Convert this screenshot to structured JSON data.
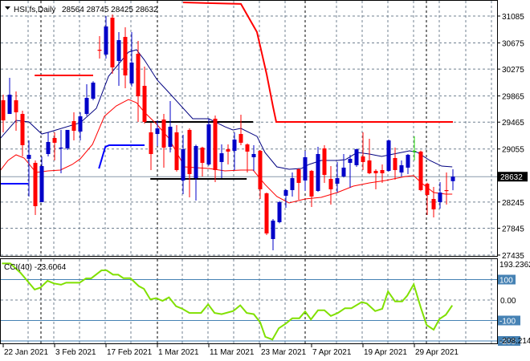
{
  "header": {
    "symbol_label": "HSI,fs,Daily",
    "ohlc": "28564 28745 28425 28632"
  },
  "price_axis": {
    "labels": [
      31085,
      30675,
      30275,
      29865,
      29465,
      29055,
      28245,
      27845,
      27435
    ],
    "current": 28632,
    "current_label": "28632"
  },
  "cci": {
    "label": "CCI(40) -23.6064",
    "max_label": "193.2362",
    "min_label": "-208.214",
    "levels": [
      {
        "value": 100,
        "label": "100",
        "boxed": true
      },
      {
        "value": 0,
        "label": "0.00",
        "boxed": false
      },
      {
        "value": -100,
        "label": "-100",
        "boxed": true
      },
      {
        "value": -200,
        "label": "-200",
        "boxed": true
      }
    ]
  },
  "dates": [
    {
      "bar": 0,
      "label": "22 Jan 2021"
    },
    {
      "bar": 8,
      "label": "3 Feb 2021"
    },
    {
      "bar": 16,
      "label": "17 Feb 2021"
    },
    {
      "bar": 24,
      "label": "1 Mar 2021"
    },
    {
      "bar": 32,
      "label": "11 Mar 2021"
    },
    {
      "bar": 40,
      "label": "23 Mar 2021"
    },
    {
      "bar": 48,
      "label": "7 Apr 2021"
    },
    {
      "bar": 56,
      "label": "19 Apr 2021"
    },
    {
      "bar": 64,
      "label": "29 Apr 2021"
    }
  ],
  "colors": {
    "bull": "#0000C8",
    "bear": "#FF0000",
    "doji": "#22DD00",
    "ma_fast": "#000080",
    "ma_slow": "#FF0000",
    "cci": "#80E000",
    "level": "#4682B4",
    "grid": "#708090"
  },
  "chart_data": {
    "type": "candlestick",
    "title": "HSI,fs,Daily",
    "ylim": [
      27435,
      31085
    ],
    "ohlc": [
      [
        29799,
        29884,
        29309,
        29492
      ],
      [
        29590,
        30142,
        29590,
        29884
      ],
      [
        29799,
        29933,
        29333,
        29615
      ],
      [
        29590,
        29639,
        28941,
        29113
      ],
      [
        28904,
        29186,
        28329,
        28966
      ],
      [
        28843,
        28880,
        28047,
        28182
      ],
      [
        28243,
        28941,
        28243,
        28794
      ],
      [
        28978,
        29309,
        28941,
        29162
      ],
      [
        29223,
        29309,
        28880,
        29150
      ],
      [
        29064,
        29346,
        28684,
        29076
      ],
      [
        29064,
        29346,
        29040,
        29346
      ],
      [
        29480,
        29615,
        29186,
        29333
      ],
      [
        29321,
        29615,
        29186,
        29554
      ],
      [
        29590,
        30044,
        29560,
        29835
      ],
      [
        29823,
        30090,
        29799,
        30068
      ],
      [
        30570,
        30779,
        30436,
        30558
      ],
      [
        30497,
        31085,
        30436,
        30926
      ],
      [
        31060,
        31110,
        30203,
        30301
      ],
      [
        30399,
        30840,
        30019,
        30717
      ],
      [
        30766,
        30913,
        29982,
        30178
      ],
      [
        30056,
        30840,
        30007,
        30374
      ],
      [
        30509,
        30705,
        29468,
        29860
      ],
      [
        30019,
        30313,
        29440,
        29468
      ],
      [
        29309,
        29456,
        28733,
        28978
      ],
      [
        29284,
        29492,
        29100,
        29370
      ],
      [
        29505,
        29590,
        28770,
        29076
      ],
      [
        29088,
        29786,
        29002,
        29395
      ],
      [
        29309,
        29419,
        28710,
        28733
      ],
      [
        28574,
        29272,
        28365,
        29051
      ],
      [
        29346,
        29370,
        28316,
        28672
      ],
      [
        28610,
        29120,
        28267,
        29100
      ],
      [
        29076,
        29090,
        28635,
        28843
      ],
      [
        28819,
        29517,
        28800,
        29431
      ],
      [
        29517,
        29566,
        28549,
        28733
      ],
      [
        28856,
        29125,
        28610,
        28990
      ],
      [
        29051,
        29125,
        28819,
        29015
      ],
      [
        29027,
        29309,
        28733,
        29199
      ],
      [
        29284,
        29578,
        29113,
        29150
      ],
      [
        29125,
        29140,
        28696,
        29015
      ],
      [
        28929,
        29113,
        28721,
        28978
      ],
      [
        29027,
        29040,
        28292,
        28439
      ],
      [
        28378,
        28390,
        27741,
        27765
      ],
      [
        27680,
        27986,
        27508,
        27961
      ],
      [
        27937,
        28260,
        27920,
        28243
      ],
      [
        28341,
        28440,
        28157,
        28427
      ],
      [
        28427,
        28696,
        28329,
        28610
      ],
      [
        28745,
        28760,
        28280,
        28537
      ],
      [
        28574,
        29027,
        28414,
        28929
      ],
      [
        28721,
        28735,
        28169,
        28329
      ],
      [
        28414,
        29088,
        28400,
        28978
      ],
      [
        29064,
        29113,
        28537,
        28659
      ],
      [
        28598,
        28794,
        28206,
        28439
      ],
      [
        28525,
        28856,
        28390,
        28610
      ],
      [
        28635,
        28978,
        28620,
        28770
      ],
      [
        28843,
        28966,
        28464,
        28904
      ],
      [
        28807,
        29060,
        28782,
        29051
      ],
      [
        28941,
        29309,
        28733,
        28856
      ],
      [
        28880,
        29211,
        28670,
        28684
      ],
      [
        28721,
        28745,
        28439,
        28684
      ],
      [
        28733,
        28819,
        28537,
        28684
      ],
      [
        28721,
        29200,
        28710,
        29186
      ],
      [
        28917,
        29076,
        28586,
        28733
      ],
      [
        28696,
        28880,
        28635,
        28807
      ],
      [
        28770,
        28980,
        28672,
        28966
      ],
      [
        29027,
        29247,
        28880,
        29027
      ],
      [
        29015,
        29030,
        28410,
        28427
      ],
      [
        28525,
        28540,
        28047,
        28353
      ],
      [
        28292,
        28476,
        28010,
        28133
      ],
      [
        28243,
        28549,
        28145,
        28390
      ],
      [
        28427,
        28696,
        28206,
        28415
      ],
      [
        28564,
        28745,
        28425,
        28632
      ]
    ],
    "ma_fast": [
      [
        -0.5,
        29211
      ],
      [
        2,
        29492
      ],
      [
        4,
        29468
      ],
      [
        6,
        29284
      ],
      [
        7,
        29309
      ],
      [
        12,
        29456
      ],
      [
        14.5,
        29676
      ],
      [
        16.4,
        30166
      ],
      [
        19.5,
        30534
      ],
      [
        20.75,
        30571
      ],
      [
        22,
        30411
      ],
      [
        24,
        30105
      ],
      [
        25.75,
        29921
      ],
      [
        29.5,
        29517
      ],
      [
        32,
        29517
      ],
      [
        34.5,
        29395
      ],
      [
        35.75,
        29346
      ],
      [
        37,
        29370
      ],
      [
        39.5,
        29248
      ],
      [
        40.75,
        29002
      ],
      [
        42.6,
        28782
      ],
      [
        44.5,
        28745
      ],
      [
        46.4,
        28757
      ],
      [
        47.6,
        28819
      ],
      [
        49.5,
        28880
      ],
      [
        52,
        28880
      ],
      [
        53.25,
        28892
      ],
      [
        55.1,
        29002
      ],
      [
        57,
        28978
      ],
      [
        58.9,
        28941
      ],
      [
        60.75,
        28978
      ],
      [
        63.25,
        29027
      ],
      [
        64.5,
        29002
      ],
      [
        66.4,
        28880
      ],
      [
        68.25,
        28794
      ],
      [
        69.9,
        28782
      ]
    ],
    "ma_slow": [
      [
        -0.5,
        28721
      ],
      [
        0.75,
        28880
      ],
      [
        2,
        28966
      ],
      [
        3.25,
        28917
      ],
      [
        5.1,
        28696
      ],
      [
        7,
        28721
      ],
      [
        8.9,
        28733
      ],
      [
        10.75,
        28819
      ],
      [
        12,
        28905
      ],
      [
        13.9,
        29125
      ],
      [
        15.75,
        29554
      ],
      [
        17.6,
        29713
      ],
      [
        19.5,
        29811
      ],
      [
        20.75,
        29762
      ],
      [
        22,
        29615
      ],
      [
        23.9,
        29431
      ],
      [
        25.75,
        29223
      ],
      [
        28.25,
        28782
      ],
      [
        32,
        28757
      ],
      [
        34.5,
        28721
      ],
      [
        37,
        28733
      ],
      [
        38.9,
        28733
      ],
      [
        40.75,
        28513
      ],
      [
        42.6,
        28329
      ],
      [
        44.5,
        28231
      ],
      [
        47,
        28292
      ],
      [
        49.5,
        28316
      ],
      [
        52,
        28390
      ],
      [
        54.5,
        28488
      ],
      [
        57,
        28537
      ],
      [
        59.5,
        28574
      ],
      [
        62.6,
        28635
      ],
      [
        63.9,
        28648
      ],
      [
        65.1,
        28537
      ],
      [
        67,
        28390
      ],
      [
        68.9,
        28365
      ],
      [
        69.9,
        28365
      ]
    ],
    "level_lines": [
      {
        "name": "red-resistance-early",
        "color": "#FF0000",
        "points": [
          [
            4.9,
            30178
          ],
          [
            14,
            30178
          ]
        ]
      },
      {
        "name": "red-trailing-stop",
        "color": "#FF0000",
        "points": [
          [
            28,
            31293
          ],
          [
            37,
            31270
          ],
          [
            39.5,
            30840
          ],
          [
            41,
            30200
          ],
          [
            42,
            29700
          ],
          [
            42.5,
            29468
          ],
          [
            70,
            29468
          ]
        ]
      },
      {
        "name": "blue-support-early",
        "color": "#0000FF",
        "points": [
          [
            -0.5,
            28525
          ],
          [
            3.9,
            28525
          ]
        ]
      },
      {
        "name": "blue-trailing-stop",
        "color": "#0000FF",
        "points": [
          [
            14.9,
            28757
          ],
          [
            15.9,
            29088
          ],
          [
            16.5,
            29113
          ],
          [
            22,
            29113
          ]
        ]
      },
      {
        "name": "black-range-top",
        "color": "#000000",
        "points": [
          [
            22,
            29468
          ],
          [
            38.9,
            29468
          ]
        ]
      },
      {
        "name": "black-range-bottom",
        "color": "#000000",
        "points": [
          [
            22.9,
            28598
          ],
          [
            37.9,
            28598
          ]
        ]
      }
    ],
    "cci_series": [
      [
        -0.2,
        179
      ],
      [
        1.1,
        179
      ],
      [
        2.7,
        133
      ],
      [
        4.9,
        51
      ],
      [
        5.8,
        61
      ],
      [
        6.9,
        94
      ],
      [
        7.9,
        81
      ],
      [
        9,
        75
      ],
      [
        9.8,
        85
      ],
      [
        11.9,
        85
      ],
      [
        12.9,
        106
      ],
      [
        13.7,
        106
      ],
      [
        15.3,
        145
      ],
      [
        16.1,
        145
      ],
      [
        17.1,
        124
      ],
      [
        17.9,
        124
      ],
      [
        18.7,
        107
      ],
      [
        19.8,
        107
      ],
      [
        21.1,
        68
      ],
      [
        21.9,
        55
      ],
      [
        22.9,
        3
      ],
      [
        23.8,
        9
      ],
      [
        24.8,
        -4
      ],
      [
        25.8,
        13
      ],
      [
        26.9,
        -30
      ],
      [
        27.9,
        -43
      ],
      [
        29,
        -63
      ],
      [
        30.8,
        -63
      ],
      [
        31.9,
        -21
      ],
      [
        32.9,
        -63
      ],
      [
        34,
        -69
      ],
      [
        35.8,
        -54
      ],
      [
        36.9,
        -26
      ],
      [
        37.9,
        -63
      ],
      [
        39,
        -69
      ],
      [
        40,
        -109
      ],
      [
        40.8,
        -180
      ],
      [
        41.9,
        -193
      ],
      [
        42.9,
        -138
      ],
      [
        44,
        -115
      ],
      [
        45,
        -89
      ],
      [
        46.1,
        -89
      ],
      [
        47,
        -56
      ],
      [
        47.9,
        -95
      ],
      [
        49,
        -50
      ],
      [
        50,
        -50
      ],
      [
        51,
        -78
      ],
      [
        52.1,
        -63
      ],
      [
        53.2,
        -40
      ],
      [
        54.2,
        -40
      ],
      [
        55.8,
        -10
      ],
      [
        56.6,
        -17
      ],
      [
        57.9,
        -54
      ],
      [
        59,
        -43
      ],
      [
        59.9,
        42
      ],
      [
        61,
        -7
      ],
      [
        62.1,
        -7
      ],
      [
        62.9,
        22
      ],
      [
        63.9,
        77
      ],
      [
        65,
        -37
      ],
      [
        65.9,
        -122
      ],
      [
        67,
        -145
      ],
      [
        67.9,
        -93
      ],
      [
        68.9,
        -72
      ],
      [
        69.9,
        -26
      ]
    ],
    "cci_range": [
      -208.214,
      193.2362
    ]
  }
}
